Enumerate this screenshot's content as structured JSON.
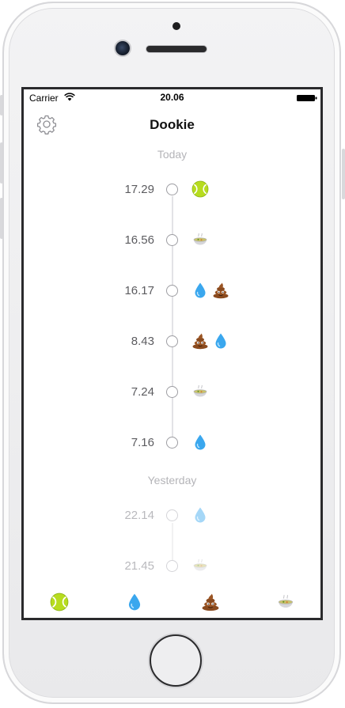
{
  "status_bar": {
    "carrier": "Carrier",
    "time": "20.06",
    "wifi_icon": "wifi-icon",
    "battery_icon": "battery-full-icon"
  },
  "nav": {
    "title": "Dookie",
    "settings_icon": "gear-icon"
  },
  "sections": [
    {
      "header": "Today",
      "entries": [
        {
          "time": "17.29",
          "icons": [
            "tennis-ball-icon"
          ]
        },
        {
          "time": "16.56",
          "icons": [
            "soup-bowl-icon"
          ]
        },
        {
          "time": "16.17",
          "icons": [
            "water-drop-icon",
            "poop-icon"
          ]
        },
        {
          "time": "8.43",
          "icons": [
            "poop-icon",
            "water-drop-icon"
          ]
        },
        {
          "time": "7.24",
          "icons": [
            "soup-bowl-icon"
          ]
        },
        {
          "time": "7.16",
          "icons": [
            "water-drop-icon"
          ]
        }
      ]
    },
    {
      "header": "Yesterday",
      "entries": [
        {
          "time": "22.14",
          "icons": [
            "water-drop-icon"
          ]
        },
        {
          "time": "21.45",
          "icons": [
            "soup-bowl-icon"
          ]
        }
      ]
    }
  ],
  "tab_bar": {
    "buttons": [
      {
        "icon": "tennis-ball-icon"
      },
      {
        "icon": "water-drop-icon"
      },
      {
        "icon": "poop-icon"
      },
      {
        "icon": "soup-bowl-icon"
      }
    ]
  },
  "colors": {
    "tennis_ball": "#b7dc1f",
    "water_drop": "#3aa7ee",
    "poop": "#8a4a1e",
    "muted_text": "#b4b4b8"
  }
}
